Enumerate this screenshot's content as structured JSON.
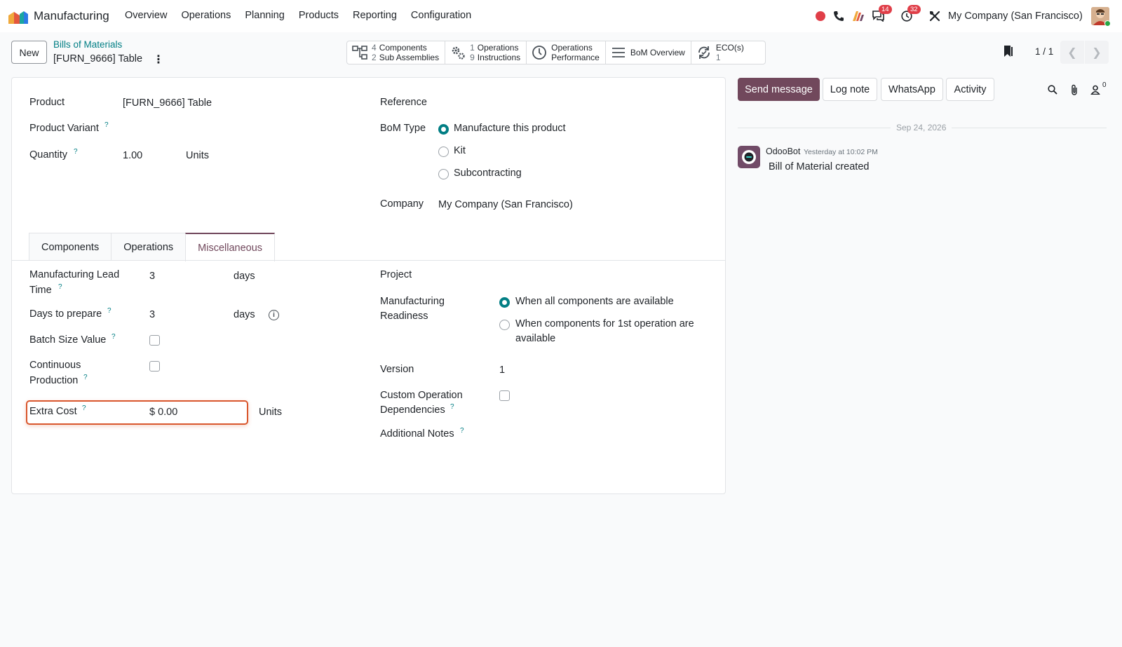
{
  "app": {
    "name": "Manufacturing",
    "menu": [
      "Overview",
      "Operations",
      "Planning",
      "Products",
      "Reporting",
      "Configuration"
    ]
  },
  "systray": {
    "messages_count": "14",
    "activities_count": "32",
    "company": "My Company (San Francisco)"
  },
  "control_panel": {
    "new_label": "New",
    "breadcrumb": "Bills of Materials",
    "record_name": "[FURN_9666] Table",
    "pager_value": "1 / 1"
  },
  "smart_buttons": {
    "components_count": "4",
    "components_label": "Components",
    "subassemblies_count": "2",
    "subassemblies_label": "Sub Assemblies",
    "operations_count": "1",
    "operations_label": "Operations",
    "instructions_count": "9",
    "instructions_label": "Instructions",
    "perf_line1": "Operations",
    "perf_line2": "Performance",
    "bom_overview": "BoM Overview",
    "eco_label": "ECO(s)",
    "eco_count": "1"
  },
  "form": {
    "product_label": "Product",
    "product_value": "[FURN_9666] Table",
    "variant_label": "Product Variant",
    "quantity_label": "Quantity",
    "quantity_value": "1.00",
    "quantity_uom": "Units",
    "reference_label": "Reference",
    "bom_type_label": "BoM Type",
    "bom_type_options": [
      "Manufacture this product",
      "Kit",
      "Subcontracting"
    ],
    "bom_type_selected": "Manufacture this product",
    "company_label": "Company",
    "company_value": "My Company (San Francisco)",
    "help_mark": "?"
  },
  "tabs": [
    "Components",
    "Operations",
    "Miscellaneous"
  ],
  "active_tab": "Miscellaneous",
  "misc": {
    "lead_time_label_1": "Manufacturing Lead",
    "lead_time_label_2": "Time",
    "lead_time_value": "3",
    "lead_time_unit": "days",
    "prepare_label": "Days to prepare",
    "prepare_value": "3",
    "prepare_unit": "days",
    "batch_label": "Batch Size Value",
    "batch_checked": false,
    "continuous_label_1": "Continuous",
    "continuous_label_2": "Production",
    "continuous_checked": false,
    "extra_cost_label": "Extra Cost",
    "extra_cost_value": "$ 0.00",
    "extra_cost_unit": "Units",
    "project_label": "Project",
    "readiness_label_1": "Manufacturing",
    "readiness_label_2": "Readiness",
    "readiness_option_1": "When all components are available",
    "readiness_option_2_line1": "When components for 1st operation are",
    "readiness_option_2_line2": "available",
    "readiness_selected": "When all components are available",
    "version_label": "Version",
    "version_value": "1",
    "custom_dep_label_1": "Custom Operation",
    "custom_dep_label_2": "Dependencies",
    "custom_dep_checked": false,
    "notes_label": "Additional Notes"
  },
  "chatter": {
    "send_message": "Send message",
    "log_note": "Log note",
    "whatsapp": "WhatsApp",
    "activity": "Activity",
    "followers_count": "0",
    "date_separator": "Sep 24, 2026",
    "author": "OdooBot",
    "message_time": "Yesterday at 10:02 PM",
    "message_body": "Bill of Material created"
  },
  "colors": {
    "accent": "#017e84",
    "brand": "#71485c",
    "highlight": "#d9562c",
    "badge": "#e03e48"
  }
}
